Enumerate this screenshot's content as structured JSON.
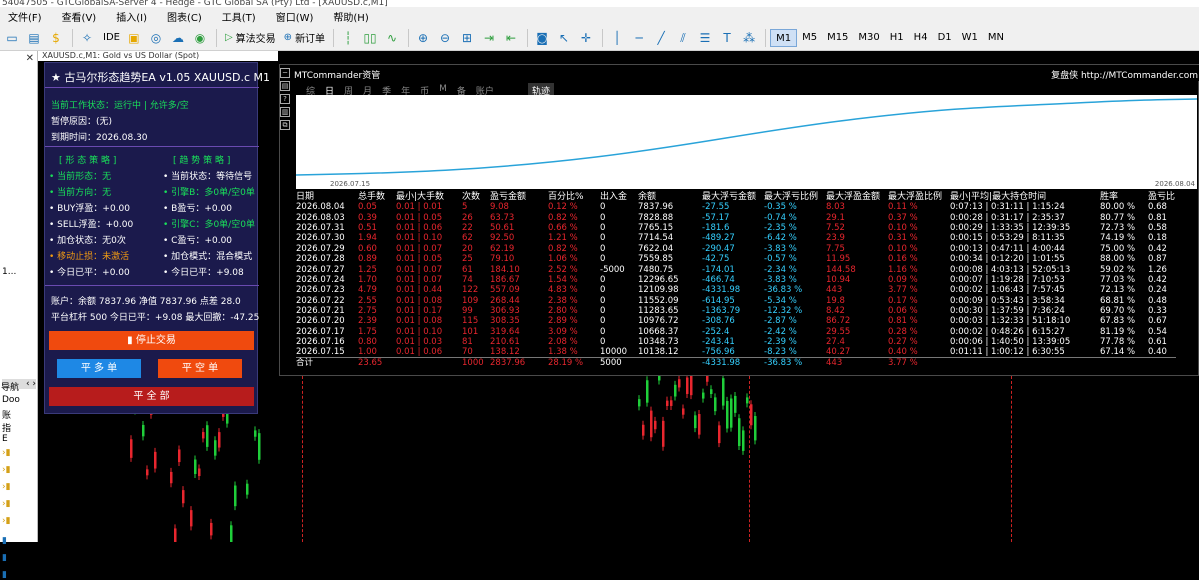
{
  "window_title": "54047505 - GTCGlobalSA-Server 4 - Hedge - GTC Global SA (Pty) Ltd - [XAUUSD.c,M1]",
  "menu": [
    "文件(F)",
    "查看(V)",
    "插入(I)",
    "图表(C)",
    "工具(T)",
    "窗口(W)",
    "帮助(H)"
  ],
  "toolbar": {
    "ide": "IDE",
    "algo_trading": "算法交易",
    "new_order": "新订单",
    "timeframes": [
      "M1",
      "M5",
      "M15",
      "M30",
      "H1",
      "H4",
      "D1",
      "W1",
      "MN"
    ],
    "active_timeframe": "M1"
  },
  "chart_tab_label": "XAUUSD.c,M1: Gold vs US Dollar (Spot)",
  "left_strip": {
    "label_1": "1...",
    "nav_title": "导航",
    "items": [
      "Doo",
      "账",
      "指",
      "E"
    ]
  },
  "ea_panel": {
    "title": "★ 古马尔形态趋势EA v1.05  XAUUSD.c  M1",
    "status": "当前工作状态：运行中 | 允许多/空",
    "pause_reason": "暂停原因：(无)",
    "expiry": "到期时间：2026.08.30",
    "section_left": "[ 形 态 策 略 ]",
    "section_right": "[ 趋 势 策 略 ]",
    "left_rows": [
      {
        "text": "• 当前形态：无",
        "color": "green"
      },
      {
        "text": "• 当前方向：无",
        "color": "green"
      },
      {
        "text": "• BUY浮盈：+0.00",
        "color": "white"
      },
      {
        "text": "• SELL浮盈：+0.00",
        "color": "white"
      },
      {
        "text": "• 加仓状态：无0次",
        "color": "white"
      },
      {
        "text": "• 移动止损：未激活",
        "color": "orange"
      },
      {
        "text": "• 今日已平：+0.00",
        "color": "white"
      }
    ],
    "right_rows": [
      {
        "text": "• 当前状态：等待信号",
        "color": "white"
      },
      {
        "text": "• 引擎B：多0单/空0单",
        "color": "green"
      },
      {
        "text": "• B盈亏：+0.00",
        "color": "white"
      },
      {
        "text": "• 引擎C：多0单/空0单",
        "color": "green"
      },
      {
        "text": "• C盈亏：+0.00",
        "color": "white"
      },
      {
        "text": "• 加仓模式：混合模式",
        "color": "white"
      },
      {
        "text": "• 今日已平：+9.08",
        "color": "white"
      }
    ],
    "account_line": "账户：余额 7837.96  净值 7837.96  点差 28.0",
    "leverage_line": "平台杠杆 500   今日已平：+9.08   最大回撤：-47.25",
    "stop_button": "▮ 停止交易",
    "close_buy_button": "平 多 单",
    "close_sell_button": "平 空 单",
    "close_all_button": "平 全 部",
    "colors": {
      "panel_bg": "#1b1a4c",
      "stop": "#f04a0e",
      "close_buy": "#1e88e5",
      "close_sell": "#f04a0e",
      "close_all": "#b71c1c"
    }
  },
  "mtc": {
    "title": "MTCommander资管",
    "url": "复盘侠 http://MTCommander.com",
    "tabs": [
      "综",
      "日",
      "周",
      "月",
      "季",
      "年",
      "币",
      "M",
      "备",
      "账户"
    ],
    "active_tab": "日",
    "track_label": "轨迹",
    "date_start": "2026.07.15",
    "date_end": "2026.08.04",
    "columns": [
      "日期",
      "总手数",
      "最小|大手数",
      "次数",
      "盈亏金额",
      "百分比%",
      "出入金",
      "余额",
      "最大浮亏金额",
      "最大浮亏比例",
      "最大浮盈金额",
      "最大浮盈比例",
      "最小|平均|最大持仓时间",
      "胜率",
      "盈亏比"
    ],
    "rows": [
      [
        "2026.08.04",
        "0.05",
        "0.01 | 0.01",
        "5",
        "9.08",
        "0.12 %",
        "0",
        "7837.96",
        "-27.55",
        "-0.35 %",
        "8.03",
        "0.11 %",
        "0:07:13 | 0:31:11 | 1:15:24",
        "80.00 %",
        "0.68"
      ],
      [
        "2026.08.03",
        "0.39",
        "0.01 | 0.05",
        "26",
        "63.73",
        "0.82 %",
        "0",
        "7828.88",
        "-57.17",
        "-0.74 %",
        "29.1",
        "0.37 %",
        "0:00:28 | 0:31:17 | 2:35:37",
        "80.77 %",
        "0.81"
      ],
      [
        "2026.07.31",
        "0.51",
        "0.01 | 0.06",
        "22",
        "50.61",
        "0.66 %",
        "0",
        "7765.15",
        "-181.6",
        "-2.35 %",
        "7.52",
        "0.10 %",
        "0:00:29 | 1:33:35 | 12:39:35",
        "72.73 %",
        "0.58"
      ],
      [
        "2026.07.30",
        "1.94",
        "0.01 | 0.10",
        "62",
        "92.50",
        "1.21 %",
        "0",
        "7714.54",
        "-489.27",
        "-6.42 %",
        "23.9",
        "0.31 %",
        "0:00:15 | 0:53:29 | 8:11:35",
        "74.19 %",
        "0.18"
      ],
      [
        "2026.07.29",
        "0.60",
        "0.01 | 0.07",
        "20",
        "62.19",
        "0.82 %",
        "0",
        "7622.04",
        "-290.47",
        "-3.83 %",
        "7.75",
        "0.10 %",
        "0:00:13 | 0:47:11 | 4:00:44",
        "75.00 %",
        "0.42"
      ],
      [
        "2026.07.28",
        "0.89",
        "0.01 | 0.05",
        "25",
        "79.10",
        "1.06 %",
        "0",
        "7559.85",
        "-42.75",
        "-0.57 %",
        "11.95",
        "0.16 %",
        "0:00:34 | 0:12:20 | 1:01:55",
        "88.00 %",
        "0.87"
      ],
      [
        "2026.07.27",
        "1.25",
        "0.01 | 0.07",
        "61",
        "184.10",
        "2.52 %",
        "-5000",
        "7480.75",
        "-174.01",
        "-2.34 %",
        "144.58",
        "1.16 %",
        "0:00:08 | 4:03:13 | 52:05:13",
        "59.02 %",
        "1.26"
      ],
      [
        "2026.07.24",
        "1.70",
        "0.01 | 0.07",
        "74",
        "186.67",
        "1.54 %",
        "0",
        "12296.65",
        "-466.74",
        "-3.83 %",
        "10.94",
        "0.09 %",
        "0:00:07 | 1:19:28 | 7:10:53",
        "77.03 %",
        "0.42"
      ],
      [
        "2026.07.23",
        "4.79",
        "0.01 | 0.44",
        "122",
        "557.09",
        "4.83 %",
        "0",
        "12109.98",
        "-4331.98",
        "-36.83 %",
        "443",
        "3.77 %",
        "0:00:02 | 1:06:43 | 7:57:45",
        "72.13 %",
        "0.24"
      ],
      [
        "2026.07.22",
        "2.55",
        "0.01 | 0.08",
        "109",
        "268.44",
        "2.38 %",
        "0",
        "11552.09",
        "-614.95",
        "-5.34 %",
        "19.8",
        "0.17 %",
        "0:00:09 | 0:53:43 | 3:58:34",
        "68.81 %",
        "0.48"
      ],
      [
        "2026.07.21",
        "2.75",
        "0.01 | 0.17",
        "99",
        "306.93",
        "2.80 %",
        "0",
        "11283.65",
        "-1363.79",
        "-12.32 %",
        "8.42",
        "0.06 %",
        "0:00:30 | 1:37:59 | 7:36:24",
        "69.70 %",
        "0.33"
      ],
      [
        "2026.07.20",
        "2.39",
        "0.01 | 0.08",
        "115",
        "308.35",
        "2.89 %",
        "0",
        "10976.72",
        "-308.76",
        "-2.87 %",
        "86.72",
        "0.81 %",
        "0:00:03 | 1:32:33 | 51:18:10",
        "67.83 %",
        "0.67"
      ],
      [
        "2026.07.17",
        "1.75",
        "0.01 | 0.10",
        "101",
        "319.64",
        "3.09 %",
        "0",
        "10668.37",
        "-252.4",
        "-2.42 %",
        "29.55",
        "0.28 %",
        "0:00:02 | 0:48:26 | 6:15:27",
        "81.19 %",
        "0.54"
      ],
      [
        "2026.07.16",
        "0.80",
        "0.01 | 0.03",
        "81",
        "210.61",
        "2.08 %",
        "0",
        "10348.73",
        "-243.41",
        "-2.39 %",
        "27.4",
        "0.27 %",
        "0:00:06 | 1:40:50 | 13:39:05",
        "77.78 %",
        "0.61"
      ],
      [
        "2026.07.15",
        "1.00",
        "0.01 | 0.06",
        "70",
        "138.12",
        "1.38 %",
        "10000",
        "10138.12",
        "-756.96",
        "-8.23 %",
        "40.27",
        "0.40 %",
        "0:01:11 | 1:00:12 | 6:30:55",
        "67.14 %",
        "0.40"
      ]
    ],
    "total": [
      "合计",
      "23.65",
      "",
      "1000",
      "2837.96",
      "28.19 %",
      "5000",
      "",
      "-4331.98",
      "-36.83 %",
      "443",
      "3.77 %",
      "",
      "",
      ""
    ],
    "colors": {
      "curve": "#29a3d9",
      "loss": "#35d0ff",
      "profit": "#e8262e"
    }
  }
}
